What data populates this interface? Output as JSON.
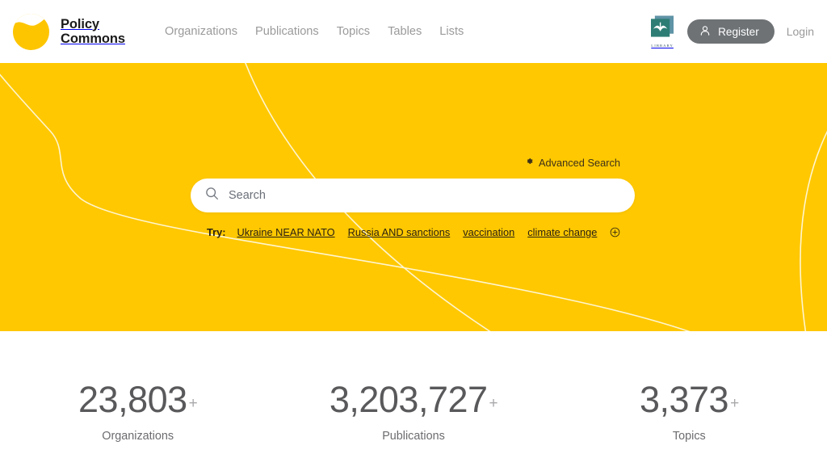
{
  "header": {
    "brand_name": "Policy\nCommons",
    "brand_logo_icon": "policy-commons-circle-logo",
    "nav": [
      {
        "label": "Organizations",
        "name": "organizations"
      },
      {
        "label": "Publications",
        "name": "publications"
      },
      {
        "label": "Topics",
        "name": "topics"
      },
      {
        "label": "Tables",
        "name": "tables"
      },
      {
        "label": "Lists",
        "name": "lists"
      }
    ],
    "library_badge": {
      "icon": "open-book-library-icon",
      "caption": "LIBRARY"
    },
    "register_label": "Register",
    "register_icon": "user-person-icon",
    "login_label": "Login"
  },
  "hero": {
    "background_color": "#ffc800",
    "advanced_search_label": "Advanced Search",
    "advanced_search_icon": "gear-icon",
    "search": {
      "icon": "search-icon",
      "placeholder": "Search",
      "value": ""
    },
    "try": {
      "label": "Try:",
      "links": [
        "Ukraine NEAR NATO",
        "Russia AND sanctions",
        "vaccination",
        "climate change"
      ],
      "more_icon": "plus-circle-icon"
    }
  },
  "stats": [
    {
      "value": "23,803",
      "suffix": "+",
      "label": "Organizations"
    },
    {
      "value": "3,203,727",
      "suffix": "+",
      "label": "Publications"
    },
    {
      "value": "3,373",
      "suffix": "+",
      "label": "Topics"
    }
  ]
}
